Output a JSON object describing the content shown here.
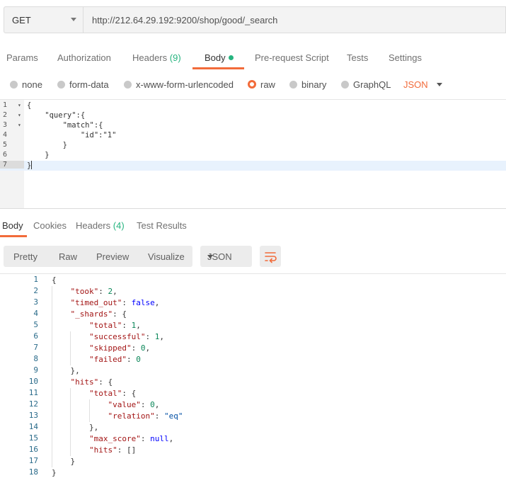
{
  "request": {
    "method": "GET",
    "url": "http://212.64.29.192:9200/shop/good/_search"
  },
  "request_tabs": [
    {
      "label": "Params"
    },
    {
      "label": "Authorization"
    },
    {
      "label": "Headers",
      "count": "(9)"
    },
    {
      "label": "Body",
      "active": true
    },
    {
      "label": "Pre-request Script"
    },
    {
      "label": "Tests"
    },
    {
      "label": "Settings"
    }
  ],
  "body_types": [
    "none",
    "form-data",
    "x-www-form-urlencoded",
    "raw",
    "binary",
    "GraphQL"
  ],
  "body_type_selected": "raw",
  "raw_format": "JSON",
  "request_body_lines": [
    {
      "n": "1",
      "fold": true,
      "text": "{"
    },
    {
      "n": "2",
      "fold": true,
      "text": "    \"query\":{"
    },
    {
      "n": "3",
      "fold": true,
      "text": "        \"match\":{"
    },
    {
      "n": "4",
      "fold": false,
      "text": "            \"id\":\"1\""
    },
    {
      "n": "5",
      "fold": false,
      "text": "        }"
    },
    {
      "n": "6",
      "fold": false,
      "text": "    }"
    },
    {
      "n": "7",
      "fold": false,
      "text": "}"
    }
  ],
  "response_tabs": [
    {
      "label": "Body",
      "active": true
    },
    {
      "label": "Cookies"
    },
    {
      "label": "Headers",
      "count": "(4)"
    },
    {
      "label": "Test Results"
    }
  ],
  "view_modes": [
    "Pretty",
    "Raw",
    "Preview",
    "Visualize"
  ],
  "response_format": "JSON",
  "response_lines": [
    {
      "n": "1",
      "indent": 0,
      "html": "{"
    },
    {
      "n": "2",
      "indent": 1,
      "key": "took",
      "val": "2",
      "t": "num",
      "comma": true
    },
    {
      "n": "3",
      "indent": 1,
      "key": "timed_out",
      "val": "false",
      "t": "kw",
      "comma": true
    },
    {
      "n": "4",
      "indent": 1,
      "key": "_shards",
      "val": "{",
      "t": "punc"
    },
    {
      "n": "5",
      "indent": 2,
      "key": "total",
      "val": "1",
      "t": "num",
      "comma": true
    },
    {
      "n": "6",
      "indent": 2,
      "key": "successful",
      "val": "1",
      "t": "num",
      "comma": true
    },
    {
      "n": "7",
      "indent": 2,
      "key": "skipped",
      "val": "0",
      "t": "num",
      "comma": true
    },
    {
      "n": "8",
      "indent": 2,
      "key": "failed",
      "val": "0",
      "t": "num"
    },
    {
      "n": "9",
      "indent": 1,
      "html": "},"
    },
    {
      "n": "10",
      "indent": 1,
      "key": "hits",
      "val": "{",
      "t": "punc"
    },
    {
      "n": "11",
      "indent": 2,
      "key": "total",
      "val": "{",
      "t": "punc"
    },
    {
      "n": "12",
      "indent": 3,
      "key": "value",
      "val": "0",
      "t": "num",
      "comma": true
    },
    {
      "n": "13",
      "indent": 3,
      "key": "relation",
      "val": "\"eq\"",
      "t": "str"
    },
    {
      "n": "14",
      "indent": 2,
      "html": "},"
    },
    {
      "n": "15",
      "indent": 2,
      "key": "max_score",
      "val": "null",
      "t": "kw",
      "comma": true
    },
    {
      "n": "16",
      "indent": 2,
      "key": "hits",
      "val": "[]",
      "t": "punc"
    },
    {
      "n": "17",
      "indent": 1,
      "html": "}"
    },
    {
      "n": "18",
      "indent": 0,
      "html": "}"
    }
  ]
}
